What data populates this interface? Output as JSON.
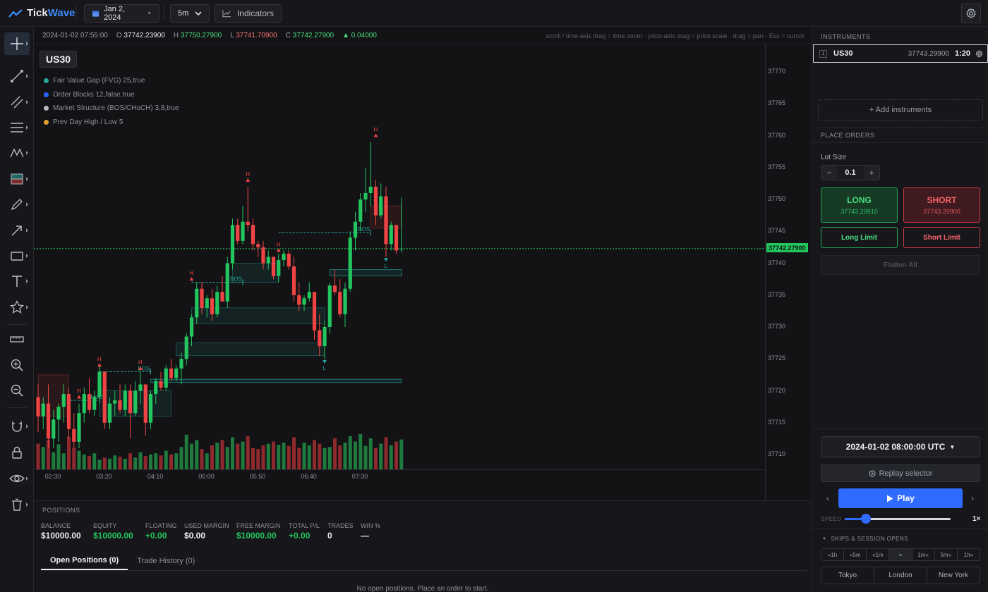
{
  "header": {
    "logo_part1": "Tick",
    "logo_part2": "Wave",
    "date": "Jan 2, 2024",
    "timeframe": "5m",
    "indicators_label": "Indicators"
  },
  "left_toolbar": {
    "tools": [
      "crosshair",
      "trend-line",
      "parallel-channel",
      "horizontal-lines",
      "zigzag-pattern",
      "long-short-position",
      "brush",
      "arrow",
      "rectangle",
      "text",
      "favorite-star",
      "ruler",
      "zoom-in",
      "zoom-out",
      "magnet",
      "lock",
      "visibility-eye",
      "delete-trash"
    ]
  },
  "chart": {
    "ohlc": {
      "datetime": "2024-01-02 07:55:00",
      "open_label": "O",
      "open": "37742.23900",
      "high_label": "H",
      "high": "37750.27900",
      "low_label": "L",
      "low": "37741.70900",
      "close_label": "C",
      "close": "37742.27900",
      "change": "0.04000"
    },
    "hint": "scroll / time-axis drag = time zoom · price-axis drag = price scale · drag = pan · Esc = cursor",
    "symbol": "US30",
    "indicators": [
      {
        "label": "Fair Value Gap (FVG) 25,true",
        "color": "#26a69a"
      },
      {
        "label": "Order Blocks 12,false,true",
        "color": "#2962ff"
      },
      {
        "label": "Market Structure (BOS/CHoCH) 3,8,true",
        "color": "#b5b8bf"
      },
      {
        "label": "Prev Day High / Low 5",
        "color": "#e0a030"
      }
    ],
    "current_price": "37742.27900",
    "colors": {
      "up": "#22c55e",
      "down": "#ef4444",
      "structure": "#26a69a"
    },
    "annotation_labels": {
      "high": "H",
      "low": "L",
      "bos": "BOS",
      "choch": "CHoCH"
    }
  },
  "chart_data": {
    "type": "candlestick",
    "price_ticks": [
      37770,
      37765,
      37760,
      37755,
      37750,
      37745,
      37740,
      37735,
      37730,
      37725,
      37720,
      37715,
      37710
    ],
    "time_ticks": [
      "02:30",
      "03:20",
      "04:10",
      "05:00",
      "05:50",
      "06:40",
      "07:30"
    ],
    "ylim": [
      37708,
      37773
    ],
    "interval_minutes": 5,
    "candles": [
      [
        37719.0,
        37721.0,
        37713.5,
        37716.0
      ],
      [
        37716.0,
        37719.0,
        37714.0,
        37718.0
      ],
      [
        37718.0,
        37721.0,
        37711.0,
        37712.5
      ],
      [
        37712.5,
        37717.0,
        37711.0,
        37715.5
      ],
      [
        37715.5,
        37718.0,
        37712.0,
        37717.5
      ],
      [
        37717.5,
        37721.0,
        37715.0,
        37719.5
      ],
      [
        37719.5,
        37720.5,
        37712.5,
        37714.0
      ],
      [
        37714.0,
        37716.5,
        37711.0,
        37712.0
      ],
      [
        37712.0,
        37718.0,
        37711.0,
        37716.5
      ],
      [
        37716.5,
        37720.5,
        37715.0,
        37719.5
      ],
      [
        37719.5,
        37722.0,
        37716.5,
        37717.0
      ],
      [
        37717.0,
        37720.0,
        37716.0,
        37719.0
      ],
      [
        37719.0,
        37724.0,
        37718.0,
        37723.0
      ],
      [
        37723.0,
        37722.0,
        37714.0,
        37715.0
      ],
      [
        37715.0,
        37719.0,
        37714.0,
        37718.0
      ],
      [
        37718.0,
        37720.0,
        37716.0,
        37718.5
      ],
      [
        37718.5,
        37721.0,
        37716.5,
        37717.0
      ],
      [
        37717.0,
        37721.0,
        37716.0,
        37720.0
      ],
      [
        37720.0,
        37721.0,
        37712.5,
        37716.5
      ],
      [
        37716.5,
        37721.5,
        37716.0,
        37720.0
      ],
      [
        37720.0,
        37723.0,
        37718.0,
        37721.0
      ],
      [
        37721.0,
        37719.5,
        37713.0,
        37715.0
      ],
      [
        37715.0,
        37720.0,
        37714.0,
        37719.5
      ],
      [
        37719.5,
        37722.0,
        37718.0,
        37721.5
      ],
      [
        37721.5,
        37723.0,
        37720.0,
        37720.5
      ],
      [
        37720.5,
        37724.0,
        37720.0,
        37723.5
      ],
      [
        37723.5,
        37725.0,
        37721.5,
        37722.0
      ],
      [
        37722.0,
        37724.0,
        37721.5,
        37723.5
      ],
      [
        37723.5,
        37726.0,
        37721.0,
        37725.0
      ],
      [
        37725.0,
        37729.0,
        37724.0,
        37728.5
      ],
      [
        37728.5,
        37732.0,
        37727.0,
        37731.5
      ],
      [
        37731.5,
        37737.0,
        37730.5,
        37736.0
      ],
      [
        37736.0,
        37737.0,
        37732.0,
        37733.0
      ],
      [
        37733.0,
        37735.0,
        37731.5,
        37734.5
      ],
      [
        37734.5,
        37736.0,
        37731.0,
        37732.0
      ],
      [
        37732.0,
        37736.5,
        37731.5,
        37735.5
      ],
      [
        37735.5,
        37738.0,
        37734.0,
        37734.0
      ],
      [
        37734.0,
        37741.0,
        37733.0,
        37740.0
      ],
      [
        37740.0,
        37747.0,
        37739.0,
        37746.0
      ],
      [
        37746.0,
        37747.0,
        37743.0,
        37743.5
      ],
      [
        37743.5,
        37749.0,
        37743.0,
        37746.5
      ],
      [
        37746.5,
        37752.0,
        37745.0,
        37746.0
      ],
      [
        37746.0,
        37747.0,
        37742.0,
        37743.0
      ],
      [
        37743.0,
        37743.5,
        37741.0,
        37742.5
      ],
      [
        37742.5,
        37743.5,
        37739.0,
        37740.0
      ],
      [
        37740.0,
        37742.0,
        37739.0,
        37741.0
      ],
      [
        37741.0,
        37741.0,
        37737.5,
        37738.0
      ],
      [
        37738.0,
        37741.5,
        37737.0,
        37740.5
      ],
      [
        37740.5,
        37742.0,
        37739.5,
        37741.5
      ],
      [
        37741.5,
        37742.0,
        37739.0,
        37739.5
      ],
      [
        37739.5,
        37741.0,
        37734.0,
        37735.0
      ],
      [
        37735.0,
        37737.0,
        37732.5,
        37733.5
      ],
      [
        37733.5,
        37735.0,
        37732.5,
        37734.5
      ],
      [
        37734.5,
        37737.0,
        37734.0,
        37735.5
      ],
      [
        37735.5,
        37734.0,
        37728.0,
        37729.5
      ],
      [
        37729.5,
        37732.0,
        37725.5,
        37727.0
      ],
      [
        37727.0,
        37731.0,
        37725.0,
        37730.0
      ],
      [
        37730.0,
        37737.0,
        37729.0,
        37736.5
      ],
      [
        37736.5,
        37739.0,
        37735.0,
        37735.5
      ],
      [
        37735.5,
        37737.5,
        37731.5,
        37732.0
      ],
      [
        37732.0,
        37737.0,
        37730.0,
        37736.0
      ],
      [
        37736.0,
        37745.0,
        37735.5,
        37744.0
      ],
      [
        37744.0,
        37748.0,
        37742.0,
        37746.5
      ],
      [
        37746.5,
        37751.0,
        37745.0,
        37750.0
      ],
      [
        37750.0,
        37755.0,
        37748.0,
        37751.0
      ],
      [
        37751.0,
        37759.0,
        37749.0,
        37752.0
      ],
      [
        37752.0,
        37753.0,
        37746.0,
        37747.5
      ],
      [
        37747.5,
        37752.5,
        37747.0,
        37750.5
      ],
      [
        37750.5,
        37752.0,
        37741.0,
        37743.0
      ],
      [
        37743.0,
        37746.5,
        37742.0,
        37746.0
      ],
      [
        37746.0,
        37746.0,
        37741.5,
        37742.0
      ],
      [
        37742.239,
        37750.279,
        37741.709,
        37742.279
      ]
    ],
    "volumes": [
      48,
      42,
      55,
      32,
      47,
      30,
      61,
      40,
      35,
      28,
      25,
      30,
      18,
      22,
      20,
      26,
      24,
      20,
      30,
      22,
      32,
      25,
      28,
      30,
      26,
      35,
      28,
      30,
      42,
      65,
      48,
      55,
      38,
      30,
      45,
      50,
      55,
      42,
      60,
      48,
      52,
      62,
      40,
      38,
      45,
      48,
      52,
      46,
      50,
      44,
      60,
      40,
      50,
      45,
      55,
      48,
      40,
      42,
      58,
      45,
      50,
      62,
      52,
      66,
      44,
      58,
      40,
      48,
      60,
      45,
      52,
      56
    ],
    "swing_highs": [
      [
        8,
        37719.0
      ],
      [
        12,
        37724.0
      ],
      [
        20,
        37723.5
      ],
      [
        30,
        37737.5
      ],
      [
        41,
        37753.0
      ],
      [
        47,
        37742.0
      ],
      [
        66,
        37760.0
      ]
    ],
    "swing_lows": [
      [
        56,
        37724.6
      ],
      [
        68,
        37740.6
      ]
    ],
    "bos_levels": [
      {
        "label": "BOS",
        "price": 37723.0,
        "from": 12,
        "to": 22
      },
      {
        "label": "BOS",
        "price": 37737.0,
        "from": 30,
        "to": 40
      },
      {
        "label": "BOS",
        "price": 37744.8,
        "from": 47,
        "to": 65
      }
    ],
    "choch_levels": [
      {
        "label": "CHoCH",
        "price": 37718.5,
        "from": 5,
        "to": 12
      }
    ],
    "fvg_zones": [
      {
        "from": 12,
        "to": 26,
        "low": 37716.0,
        "high": 37720.0
      },
      {
        "from": 27,
        "to": 56,
        "low": 37725.5,
        "high": 37727.5
      },
      {
        "from": 30,
        "to": 56,
        "low": 37730.5,
        "high": 37733.0
      },
      {
        "from": 38,
        "to": 47,
        "low": 37737.0,
        "high": 37740.0
      }
    ],
    "order_blocks": [
      {
        "from": 0,
        "to": 6,
        "low": 37716.0,
        "high": 37722.5,
        "bias": "bear"
      },
      {
        "from": 22,
        "to": 71,
        "low": 37721.3,
        "high": 37721.8,
        "bias": "bull"
      },
      {
        "from": 57,
        "to": 71,
        "low": 37738.0,
        "high": 37739.0,
        "bias": "bull"
      },
      {
        "from": 65,
        "to": 71,
        "low": 37745.5,
        "high": 37749.0,
        "bias": "bear"
      }
    ]
  },
  "positions": {
    "title": "POSITIONS",
    "stats": [
      {
        "label": "BALANCE",
        "value": "$10000.00",
        "tone": "white"
      },
      {
        "label": "EQUITY",
        "value": "$10000.00",
        "tone": "green"
      },
      {
        "label": "FLOATING",
        "value": "+0.00",
        "tone": "green"
      },
      {
        "label": "USED MARGIN",
        "value": "$0.00",
        "tone": "white"
      },
      {
        "label": "FREE MARGIN",
        "value": "$10000.00",
        "tone": "green"
      },
      {
        "label": "TOTAL P/L",
        "value": "+0.00",
        "tone": "green"
      },
      {
        "label": "TRADES",
        "value": "0",
        "tone": "white"
      },
      {
        "label": "WIN %",
        "value": "—",
        "tone": "white"
      }
    ],
    "tabs": [
      "Open Positions (0)",
      "Trade History (0)"
    ],
    "empty_message": "No open positions. Place an order to start."
  },
  "instruments": {
    "title": "INSTRUMENTS",
    "rows": [
      {
        "index": "1",
        "symbol": "US30",
        "price": "37743.29900",
        "leverage": "1:20"
      }
    ],
    "add_label": "+ Add instruments"
  },
  "orders": {
    "title": "PLACE ORDERS",
    "lot_label": "Lot Size",
    "lot_value": "0.1",
    "minus": "−",
    "plus": "+",
    "long_label": "LONG",
    "long_price": "37743.29910",
    "short_label": "SHORT",
    "short_price": "37743.29900",
    "long_limit": "Long Limit",
    "short_limit": "Short Limit",
    "flatten": "Flatten All"
  },
  "replay": {
    "datetime": "2024-01-02 08:00:00 UTC",
    "selector_label": "Replay selector",
    "play_label": "Play",
    "speed_label": "SPEED",
    "speed_value": "1×",
    "speed_fraction": 0.2,
    "skips_label": "SKIPS & SESSION OPENS",
    "skips": [
      "«1h",
      "«5m",
      "«1m",
      "=",
      "1m»",
      "5m»",
      "1h»"
    ],
    "sessions": [
      "Tokyo",
      "London",
      "New York"
    ]
  }
}
